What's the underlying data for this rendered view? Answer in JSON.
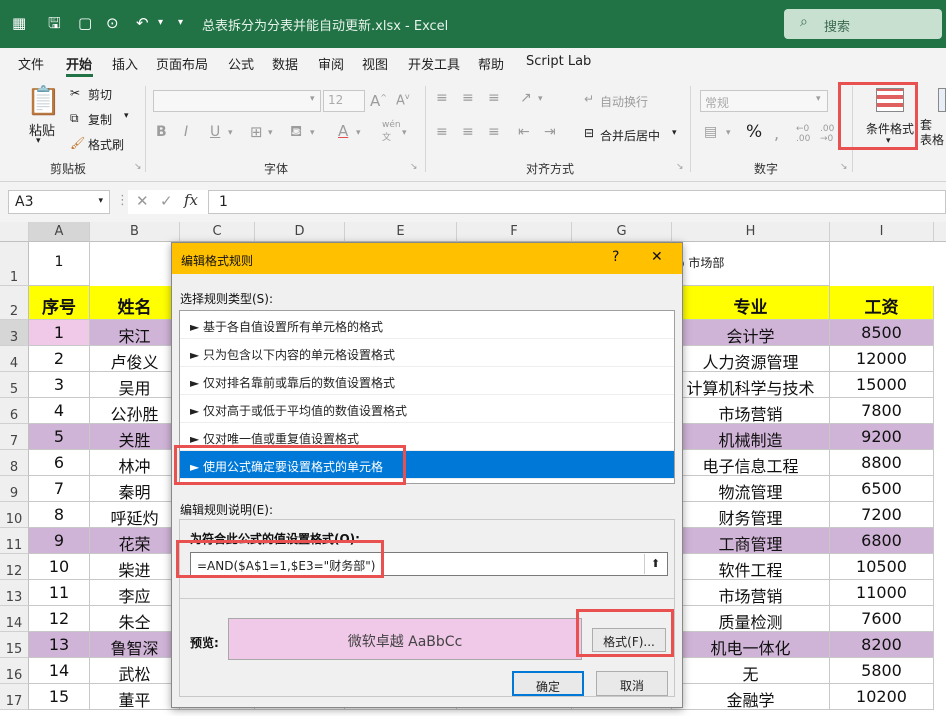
{
  "titlebar": {
    "filename": "总表拆分为分表并能自动更新.xlsx  -  Excel",
    "search_placeholder": "搜索"
  },
  "menu": [
    "文件",
    "开始",
    "插入",
    "页面布局",
    "公式",
    "数据",
    "审阅",
    "视图",
    "开发工具",
    "帮助",
    "Script Lab"
  ],
  "ribbon": {
    "paste": "粘贴",
    "cut": "剪切",
    "copy": "复制",
    "format_painter": "格式刷",
    "clipboard_group": "剪贴板",
    "font_size": "12",
    "font_group": "字体",
    "wrap_text": "自动换行",
    "merge_center": "合并后居中",
    "align_group": "对齐方式",
    "number_format": "常规",
    "number_group": "数字",
    "conditional_format": "条件格式",
    "cut_off_label": "套\n表格"
  },
  "formula_bar": {
    "name_box": "A3",
    "value": "1"
  },
  "columns": [
    "A",
    "B",
    "C",
    "D",
    "E",
    "F",
    "G",
    "H",
    "I"
  ],
  "rows": [
    "1",
    "2",
    "3",
    "4",
    "5",
    "6",
    "7",
    "8",
    "9",
    "10",
    "11",
    "12",
    "13",
    "14",
    "15",
    "16",
    "17"
  ],
  "sheet": {
    "a1": "1",
    "h1_radio": "市场部",
    "headers": {
      "seq": "序号",
      "name": "姓名",
      "major": "专业",
      "salary": "工资"
    },
    "data": [
      {
        "seq": "1",
        "name": "宋江",
        "major": "会计学",
        "salary": "8500"
      },
      {
        "seq": "2",
        "name": "卢俊义",
        "major": "人力资源管理",
        "salary": "12000"
      },
      {
        "seq": "3",
        "name": "吴用",
        "major": "计算机科学与技术",
        "salary": "15000"
      },
      {
        "seq": "4",
        "name": "公孙胜",
        "major": "市场营销",
        "salary": "7800"
      },
      {
        "seq": "5",
        "name": "关胜",
        "major": "机械制造",
        "salary": "9200"
      },
      {
        "seq": "6",
        "name": "林冲",
        "major": "电子信息工程",
        "salary": "8800"
      },
      {
        "seq": "7",
        "name": "秦明",
        "major": "物流管理",
        "salary": "6500"
      },
      {
        "seq": "8",
        "name": "呼延灼",
        "major": "财务管理",
        "salary": "7200"
      },
      {
        "seq": "9",
        "name": "花荣",
        "major": "工商管理",
        "salary": "6800"
      },
      {
        "seq": "10",
        "name": "柴进",
        "major": "软件工程",
        "salary": "10500"
      },
      {
        "seq": "11",
        "name": "李应",
        "major": "市场营销",
        "salary": "11000"
      },
      {
        "seq": "12",
        "name": "朱仝",
        "major": "质量检测",
        "salary": "7600"
      },
      {
        "seq": "13",
        "name": "鲁智深",
        "major": "机电一体化",
        "salary": "8200"
      },
      {
        "seq": "14",
        "name": "武松",
        "major": "无",
        "salary": "5800"
      },
      {
        "seq": "15",
        "name": "董平",
        "major": "金融学",
        "salary": "10200"
      }
    ]
  },
  "dialog": {
    "title": "编辑格式规则",
    "help": "?",
    "close": "✕",
    "select_type_label": "选择规则类型(S):",
    "rule_types": [
      "► 基于各自值设置所有单元格的格式",
      "► 只为包含以下内容的单元格设置格式",
      "► 仅对排名靠前或靠后的数值设置格式",
      "► 仅对高于或低于平均值的数值设置格式",
      "► 仅对唯一值或重复值设置格式",
      "► 使用公式确定要设置格式的单元格"
    ],
    "edit_desc_label": "编辑规则说明(E):",
    "formula_label": "为符合此公式的值设置格式(O):",
    "formula": "=AND($A$1=1,$E3=\"财务部\")",
    "preview_label": "预览:",
    "preview_text": "微软卓越  AaBbCc",
    "format_button": "格式(F)...",
    "ok": "确定",
    "cancel": "取消"
  },
  "colors": {
    "excel_green": "#217346",
    "header_yellow": "#ffff00",
    "highlight_purple": "#d0b4d8",
    "dialog_title": "#ffc000",
    "selected_rule": "#0078d7",
    "preview_fill": "#f0c8e8",
    "red_box": "#e8514f"
  }
}
